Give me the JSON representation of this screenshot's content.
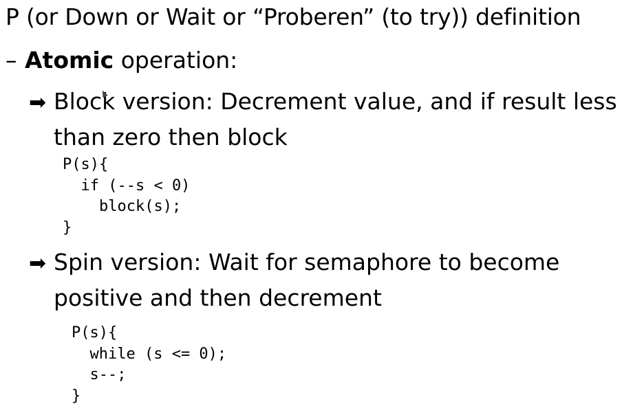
{
  "slide": {
    "title": "P (or Down or Wait or “Proberen” (to try)) definition",
    "bullet1": {
      "marker": "–",
      "bold": "Atomic",
      "text": " operation:"
    },
    "block_version": {
      "arrow": "➡",
      "line1": "Block version: Decrement value, and if result less",
      "line2": "than zero then block",
      "code": [
        "P(s){",
        "  if (--s < 0)",
        "    block(s);",
        "}"
      ]
    },
    "spin_version": {
      "arrow": "➡",
      "line1": "Spin version: Wait for semaphore to become",
      "line2": "positive and then decrement",
      "code": [
        "P(s){",
        "  while (s <= 0);",
        "  s--;",
        "}"
      ]
    }
  }
}
